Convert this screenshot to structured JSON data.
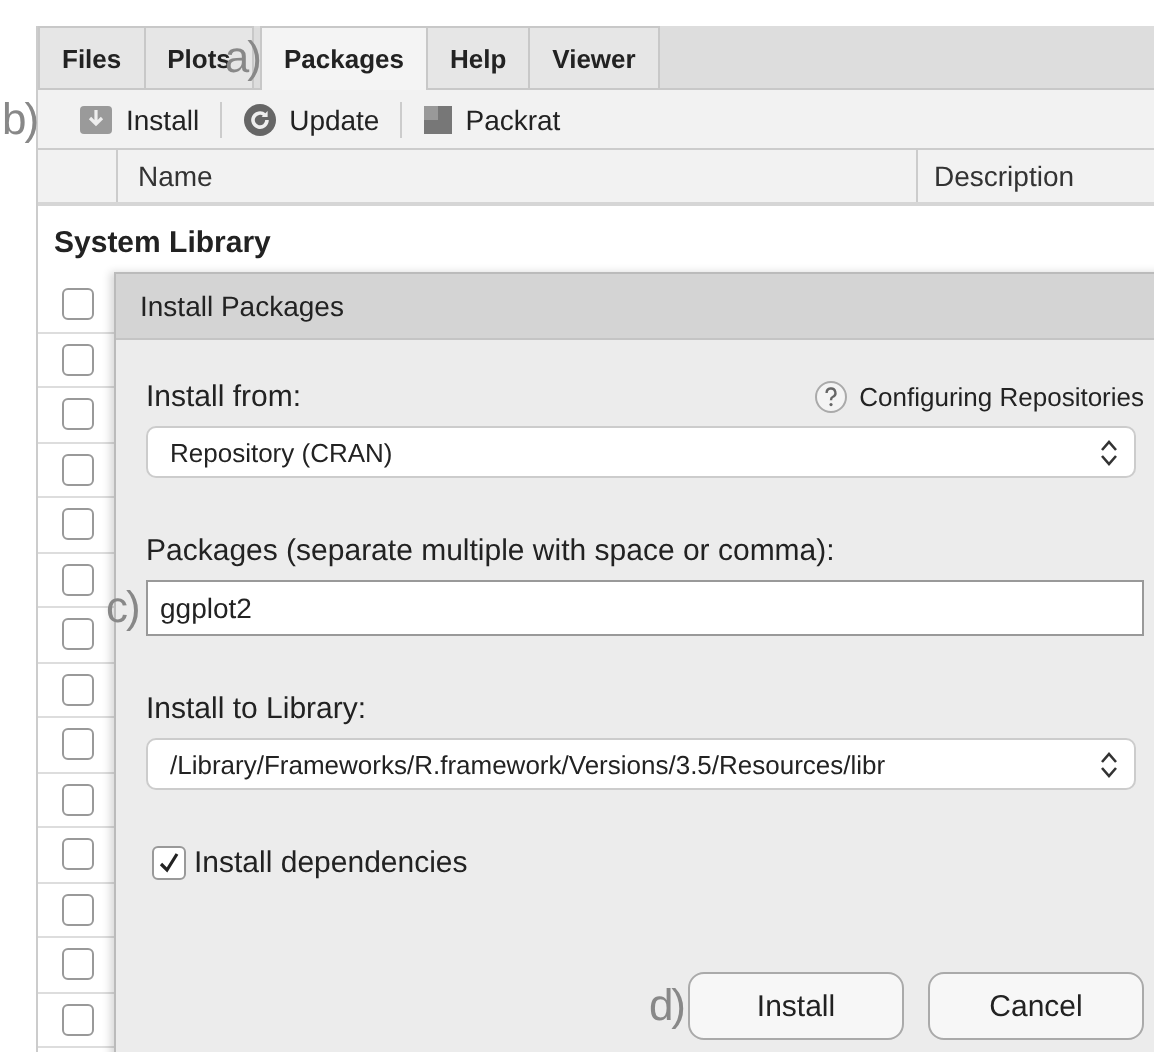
{
  "tabs": [
    {
      "label": "Files",
      "selected": false
    },
    {
      "label": "Plots",
      "selected": false
    },
    {
      "label": "Packages",
      "selected": true
    },
    {
      "label": "Help",
      "selected": false
    },
    {
      "label": "Viewer",
      "selected": false
    }
  ],
  "toolbar": [
    {
      "label": "Install"
    },
    {
      "label": "Update"
    },
    {
      "label": "Packrat"
    }
  ],
  "table": {
    "columns": [
      "Name",
      "Description"
    ],
    "group": "System Library",
    "rows": [
      {
        "checked": false
      },
      {
        "checked": false
      },
      {
        "checked": false
      },
      {
        "checked": false
      },
      {
        "checked": false
      },
      {
        "checked": false
      },
      {
        "checked": false
      },
      {
        "checked": false
      },
      {
        "checked": false
      },
      {
        "checked": false
      },
      {
        "checked": false
      },
      {
        "checked": false
      },
      {
        "checked": false
      },
      {
        "checked": false
      }
    ]
  },
  "dialog": {
    "title": "Install Packages",
    "install_from_label": "Install from:",
    "help_link": "Configuring Repositories",
    "install_from_value": "Repository (CRAN)",
    "packages_label": "Packages (separate multiple with space or comma):",
    "packages_value": "ggplot2",
    "library_label": "Install to Library:",
    "library_value": "/Library/Frameworks/R.framework/Versions/3.5/Resources/libr",
    "dependencies": {
      "label": "Install dependencies",
      "checked": true
    },
    "buttons": [
      "Install",
      "Cancel"
    ]
  },
  "annotations": [
    "a)",
    "b)",
    "c)",
    "d)"
  ]
}
